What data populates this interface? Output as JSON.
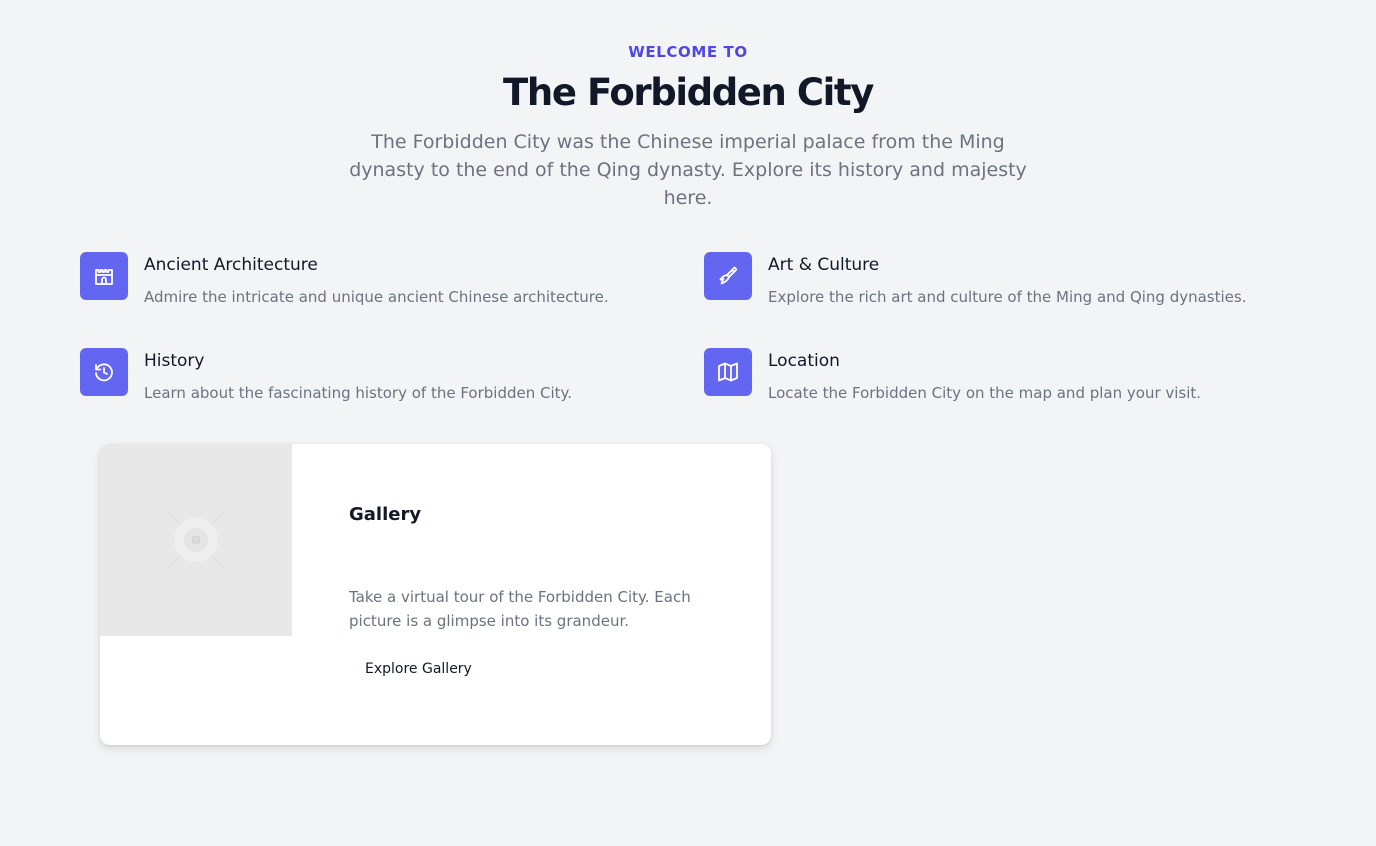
{
  "hero": {
    "eyebrow": "WELCOME TO",
    "title": "The Forbidden City",
    "description": "The Forbidden City was the Chinese imperial palace from the Ming dynasty to the end of the Qing dynasty. Explore its history and majesty here."
  },
  "features": [
    {
      "icon": "castle-icon",
      "title": "Ancient Architecture",
      "description": "Admire the intricate and unique ancient Chinese architecture."
    },
    {
      "icon": "paintbrush-icon",
      "title": "Art & Culture",
      "description": "Explore the rich art and culture of the Ming and Qing dynasties."
    },
    {
      "icon": "history-icon",
      "title": "History",
      "description": "Learn about the fascinating history of the Forbidden City."
    },
    {
      "icon": "map-icon",
      "title": "Location",
      "description": "Locate the Forbidden City on the map and plan your visit."
    }
  ],
  "gallery_card": {
    "image_icon": "image-placeholder-icon",
    "title": "Gallery",
    "description": "Take a virtual tour of the Forbidden City. Each picture is a glimpse into its grandeur.",
    "button_label": "Explore Gallery"
  },
  "colors": {
    "accent": "#4f46e5",
    "icon_background": "#6366f1",
    "page_background": "#f3f4f6",
    "heading": "#111827",
    "body_text": "#6b7280"
  }
}
